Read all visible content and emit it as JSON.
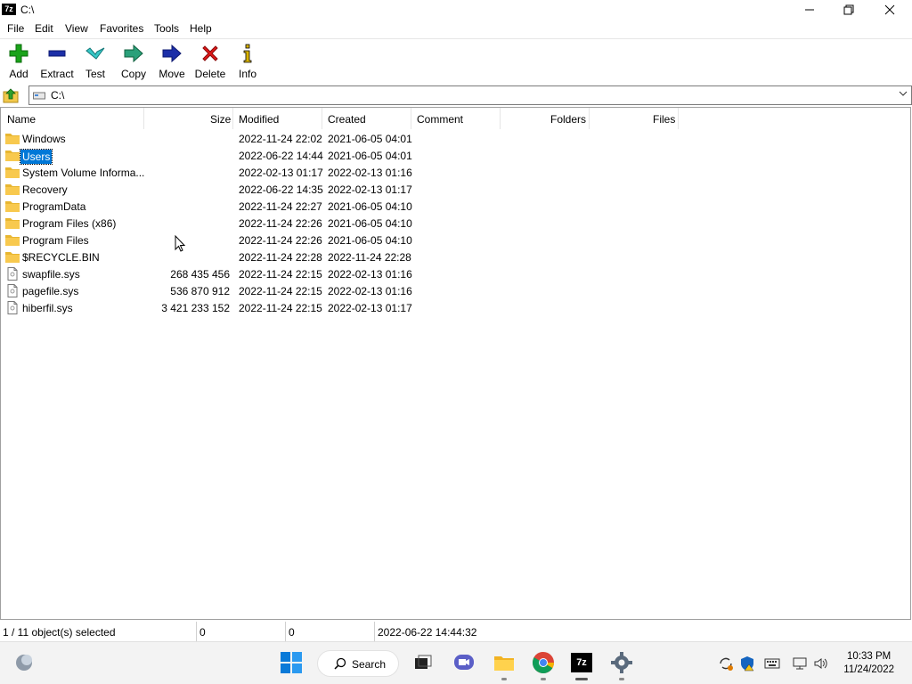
{
  "window": {
    "title": "C:\\",
    "app_icon_text": "7z",
    "minimize": "—",
    "maximize": "❐",
    "close": "✕"
  },
  "menu": [
    "File",
    "Edit",
    "View",
    "Favorites",
    "Tools",
    "Help"
  ],
  "toolbar": {
    "add": "Add",
    "extract": "Extract",
    "test": "Test",
    "copy": "Copy",
    "move": "Move",
    "delete": "Delete",
    "info": "Info"
  },
  "address": {
    "path": "C:\\"
  },
  "columns": {
    "name": "Name",
    "size": "Size",
    "modified": "Modified",
    "created": "Created",
    "comment": "Comment",
    "folders": "Folders",
    "files": "Files"
  },
  "files": [
    {
      "name": "Windows",
      "type": "folder",
      "size": "",
      "modified": "2022-11-24 22:02",
      "created": "2021-06-05 04:01"
    },
    {
      "name": "Users",
      "type": "folder",
      "size": "",
      "modified": "2022-06-22 14:44",
      "created": "2021-06-05 04:01",
      "selected": true
    },
    {
      "name": "System Volume Informa...",
      "type": "folder",
      "size": "",
      "modified": "2022-02-13 01:17",
      "created": "2022-02-13 01:16"
    },
    {
      "name": "Recovery",
      "type": "folder",
      "size": "",
      "modified": "2022-06-22 14:35",
      "created": "2022-02-13 01:17"
    },
    {
      "name": "ProgramData",
      "type": "folder",
      "size": "",
      "modified": "2022-11-24 22:27",
      "created": "2021-06-05 04:10"
    },
    {
      "name": "Program Files (x86)",
      "type": "folder",
      "size": "",
      "modified": "2022-11-24 22:26",
      "created": "2021-06-05 04:10"
    },
    {
      "name": "Program Files",
      "type": "folder",
      "size": "",
      "modified": "2022-11-24 22:26",
      "created": "2021-06-05 04:10"
    },
    {
      "name": "$RECYCLE.BIN",
      "type": "folder",
      "size": "",
      "modified": "2022-11-24 22:28",
      "created": "2022-11-24 22:28"
    },
    {
      "name": "swapfile.sys",
      "type": "file",
      "size": "268 435 456",
      "modified": "2022-11-24 22:15",
      "created": "2022-02-13 01:16"
    },
    {
      "name": "pagefile.sys",
      "type": "file",
      "size": "536 870 912",
      "modified": "2022-11-24 22:15",
      "created": "2022-02-13 01:16"
    },
    {
      "name": "hiberfil.sys",
      "type": "file",
      "size": "3 421 233 152",
      "modified": "2022-11-24 22:15",
      "created": "2022-02-13 01:17"
    }
  ],
  "status": {
    "selection": "1 / 11 object(s) selected",
    "size": "0",
    "packed": "0",
    "modified": "2022-06-22 14:44:32"
  },
  "taskbar": {
    "search_label": "Search",
    "time": "10:33 PM",
    "date": "11/24/2022"
  },
  "colors": {
    "selection": "#0078d7",
    "folder": "#f8c94e",
    "taskbar": "#f3f3f3"
  }
}
